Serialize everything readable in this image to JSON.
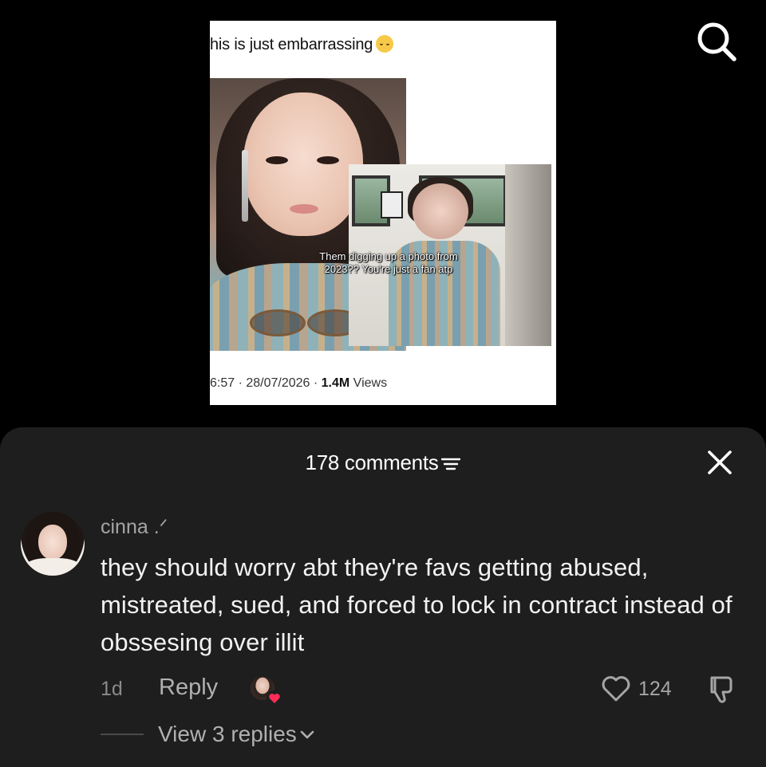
{
  "post": {
    "caption": "his is just embarrassing",
    "caption_emoji": "loudly-crying-face-icon",
    "overlay_text": "Them digging up a photo from 2023?? You're just a fan atp",
    "meta_time": "6:57 · 28/07/2026 · ",
    "meta_views": "1.4M",
    "meta_views_suffix": " Views"
  },
  "sheet": {
    "count_label": "178 comments",
    "close_icon": "close-icon",
    "sort_icon": "sort-icon"
  },
  "comment": {
    "username": "cinna .ᐟ",
    "text": "they should worry abt they're favs getting abused, mistreated, sued, and forced to lock in contract instead of obssesing over illit",
    "time": "1d",
    "reply_label": "Reply",
    "like_count": "124",
    "view_replies": "View 3 replies"
  },
  "colors": {
    "sheet_bg": "#1e1e1e",
    "heart": "#ff2d55",
    "text_primary": "#f2f2f2",
    "text_secondary": "#a5a5a5"
  },
  "icons": [
    "search-icon",
    "sort-icon",
    "close-icon",
    "heart-outline-icon",
    "thumbs-down-icon",
    "chevron-down-icon",
    "heart-badge-icon"
  ]
}
